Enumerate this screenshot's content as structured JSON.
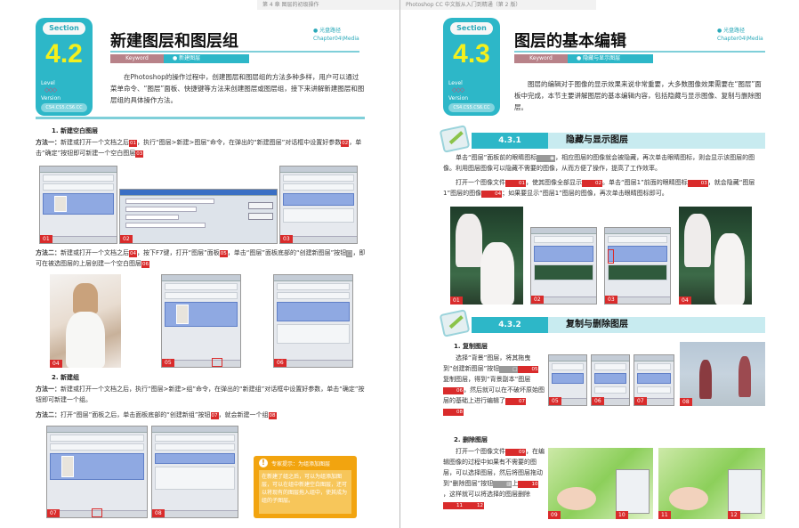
{
  "left": {
    "running_head": "第 4 章   图层的初级操作",
    "section": {
      "tag": "Section",
      "num": "4.2",
      "level": "Level",
      "diamonds": "◇◇◇",
      "version": "Version",
      "version_val": "CS4.CS5.CS6.CC"
    },
    "title": "新建图层和图层组",
    "path1": "● 光盘路径",
    "path2": "Chapter04\\Media",
    "keyword_label": "Keyword",
    "keyword_value": "● 新建图层",
    "intro": "在Photoshop的操作过程中，创建图层和图层组的方法多种多样，用户可以通过菜单命令、“图层”面板、快捷键等方法来创建图层或图层组，接下来讲解新建图层和图层组的具体操作方法。",
    "h1": "1. 新建空白图层",
    "m1_label": "方法一：",
    "m1": "新建或打开一个文档之后",
    "m1b": "，执行“图层>新建>图层”命令，在弹出的“新建图层”对话框中设置好参数",
    "m1c": "，单击“确定”按钮即可新建一个空白图层",
    "m2_label": "方法二：",
    "m2": "新建或打开一个文档之后",
    "m2b": "，按下F7键，打开“图层”面板",
    "m2c": "，单击“图层”面板底部的“创建新图层”按钮",
    "m2d": "，即可在被选图层的上层创建一个空白图层",
    "h2": "2. 新建组",
    "g1_label": "方法一：",
    "g1": "新建或打开一个文档之后，执行“图层>新建>组”命令，在弹出的“新建组”对话框中设置好参数，单击“确定”按钮即可新建一个组。",
    "g2_label": "方法二：",
    "g2": "打开“图层”面板之后，单击面板底部的“创建新组”按钮",
    "g2b": "，就会新建一个组",
    "badges": {
      "b01": "01",
      "b02": "02",
      "b03": "03",
      "b04": "04",
      "b05": "05",
      "b06": "06",
      "b07": "07",
      "b08": "08"
    },
    "note_title": "专家提示：为组添加图层",
    "note_body": "在新建了组之后，可以为组添加图层，可以在组中新建空白图层，还可以将现有的图层拖入组中，使其成为组的子图层。"
  },
  "right": {
    "running_head": "Photoshop CC 中文版从入门到精通（第 2 版）",
    "section": {
      "tag": "Section",
      "num": "4.3",
      "level": "Level",
      "diamonds": "◇◇◇",
      "version": "Version",
      "version_val": "CS4.CS5.CS6.CC"
    },
    "title": "图层的基本编辑",
    "path1": "● 光盘路径",
    "path2": "Chapter04\\Media",
    "keyword_label": "Keyword",
    "keyword_value": "● 隐藏与显示图层",
    "intro": "图层的编辑对于图像的显示效果来说非常重要，大多数图像效果需要在“图层”面板中完成，本节主要讲解图层的基本编辑内容，包括隐藏与显示图像、复制与删除图层。",
    "s1_num": "4.3.1",
    "s1_title": "隐藏与显示图层",
    "s1_p1": "单击“图层”面板前的眼睛图标",
    "s1_p1b": "，相应图层的图像就会被隐藏，再次单击眼睛图标，则会显示该图层的图像。利用图层图像可以隐藏不需要的图像，从而方便了操作，提高了工作效率。",
    "s1_p2": "打开一个图像文件",
    "s1_p2b": "，使其图像全部显示",
    "s1_p2c": "。单击“图层1”前面的眼睛图标",
    "s1_p2d": "，就会隐藏“图层1”图层的图像",
    "s1_p2e": "；如果要显示“图层1”图层的图像，再次单击眼睛图标即可。",
    "s2_num": "4.3.2",
    "s2_title": "复制与删除图层",
    "h1": "1. 复制图层",
    "c1": "选择“背景”图层，将其拖曳到“创建新图层”按钮",
    "c1b": "复制图层，得到“背景副本”图层",
    "c1c": "，然后就可以在不破坏原始图层的基础上进行编辑了",
    "h2": "2. 删除图层",
    "d1": "打开一个图像文件",
    "d1b": "，在编辑图像的过程中如果有不需要的图层，可以选择图层，然后将图层拖动到“删除图层”按钮",
    "d1c": "上",
    "d1d": "，这样就可以将选择的图层删除",
    "badges": {
      "b01": "01",
      "b02": "02",
      "b03": "03",
      "b04": "04",
      "b05": "05",
      "b06": "06",
      "b07": "07",
      "b08": "08",
      "b09": "09",
      "b10": "10",
      "b11": "11",
      "b12": "12"
    }
  }
}
